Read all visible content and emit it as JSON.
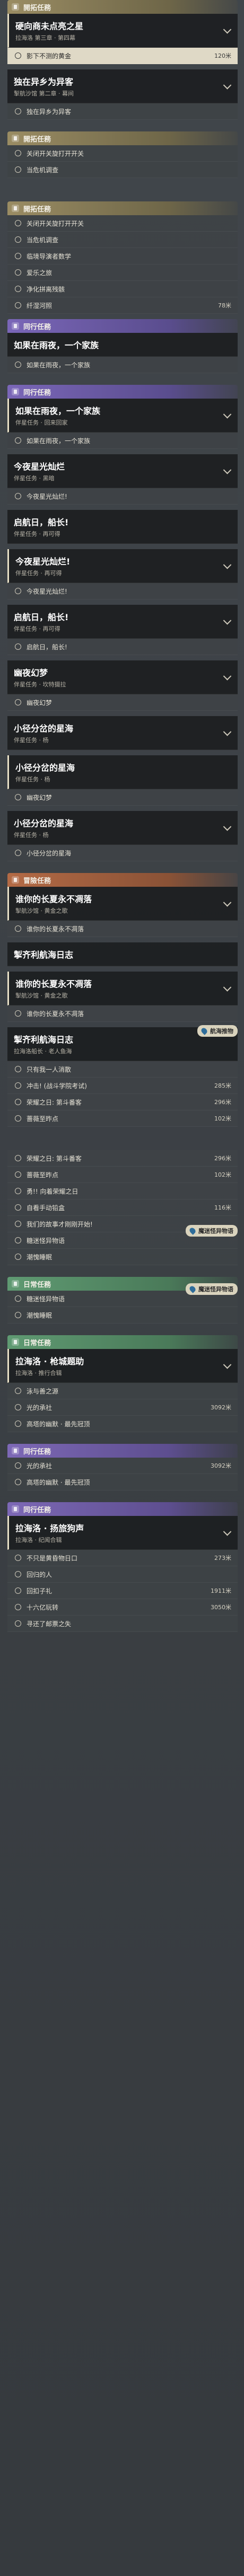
{
  "sections": {
    "trail": "開拓任務",
    "companion": "同行任務",
    "adventure": "冒險任務",
    "daily": "日常任務",
    "side": "同行任務"
  },
  "q1": {
    "title": "硬向商未点亮之星",
    "sub": "拉海洛 第三章 · 第四幕",
    "objectives": [
      {
        "label": "影下不测的黄金",
        "dist": "120米",
        "highlight": true
      }
    ]
  },
  "q2": {
    "title": "独在异乡为异客",
    "sub": "掣航沙馆 第二章 · 幕间",
    "objectives": [
      {
        "label": "独在异乡为异客",
        "dist": ""
      }
    ]
  },
  "q3": {
    "objectives": [
      {
        "label": "关闭开关旋打开开关",
        "dist": ""
      },
      {
        "label": "当危机调查",
        "dist": ""
      }
    ]
  },
  "q4": {
    "objectives": [
      {
        "label": "关闭开关旋打开开关",
        "dist": ""
      },
      {
        "label": "当危机调查",
        "dist": ""
      },
      {
        "label": "临境导演者数学",
        "dist": ""
      },
      {
        "label": "爱乐之旅",
        "dist": ""
      },
      {
        "label": "净化拼离残骸",
        "dist": ""
      },
      {
        "label": "纤湿河照",
        "dist": "78米"
      }
    ]
  },
  "q5": {
    "title": "如果在雨夜，一个家族",
    "sub": "伴星任务 · 回来回家",
    "objectives": [
      {
        "label": "如果在雨夜，一个家族",
        "dist": ""
      }
    ]
  },
  "q6": {
    "title": "今夜星光灿烂",
    "sub": "伴星任务 · 黑暗",
    "objectives": [
      {
        "label": "今夜星光灿烂!",
        "dist": ""
      }
    ]
  },
  "q7": {
    "title": "启航日，船长!",
    "sub": "伴星任务 · 再可得",
    "objectives": []
  },
  "q8": {
    "title": "今夜星光灿烂!",
    "sub": "伴星任务 · 再可得",
    "objectives": [
      {
        "label": "今夜星光灿烂!",
        "dist": ""
      }
    ]
  },
  "q9": {
    "title": "启航日，船长!",
    "sub": "伴星任务 · 再可得",
    "objectives": [
      {
        "label": "启航日，船长!",
        "dist": ""
      }
    ]
  },
  "q10": {
    "title": "幽夜幻梦",
    "sub": "伴星任务 · 坎特摄拉",
    "objectives": [
      {
        "label": "幽夜幻梦",
        "dist": ""
      }
    ]
  },
  "q11": {
    "title": "小径分岔的星海",
    "sub": "伴星任务 · 杨",
    "objectives": [
      {
        "label": "幽夜幻梦",
        "dist": ""
      }
    ]
  },
  "q12": {
    "title": "小径分岔的星海",
    "sub": "伴星任务 · 杨",
    "objectives": [
      {
        "label": "小径分岔的星海",
        "dist": ""
      }
    ]
  },
  "q13": {
    "title": "谁你的长夏永不凋落",
    "sub": "掣航沙馆 · 黄金之歌",
    "objectives": [
      {
        "label": "谁你的长夏永不凋落",
        "dist": ""
      }
    ]
  },
  "q14": {
    "title": "掣齐利航海日志",
    "sub": "",
    "objectives": []
  },
  "q15": {
    "title": "谁你的长夏永不凋落",
    "sub": "掣航沙馆 · 黄金之歌",
    "objectives": [
      {
        "label": "谁你的长夏永不凋落",
        "dist": ""
      }
    ]
  },
  "q16": {
    "title": "掣齐利航海日志",
    "sub": "拉海洛船长 · 老人鱼海",
    "tag": "航海推物",
    "objectives": [
      {
        "label": "只有我一人消散",
        "dist": ""
      },
      {
        "label": "冲击! (战斗学院考试)",
        "dist": "285米"
      },
      {
        "label": "荣耀之日: 第斗番客",
        "dist": "296米"
      },
      {
        "label": "蔷薇至昨点",
        "dist": "102米"
      }
    ]
  },
  "q17": {
    "objectives": [
      {
        "label": "荣耀之日: 第斗番客",
        "dist": "296米"
      },
      {
        "label": "蔷薇至昨点",
        "dist": "102米"
      },
      {
        "label": "勇!!  向着荣耀之日",
        "dist": ""
      },
      {
        "label": "自看手动铅盒",
        "dist": "116米"
      },
      {
        "label": "我们的故事才刚刚开始!",
        "dist": ""
      },
      {
        "label": "糖迷怪异物语",
        "dist": ""
      },
      {
        "label": "潮愧睡眠",
        "dist": ""
      }
    ],
    "tag": "魔迷怪异物语"
  },
  "q18": {
    "tag": "魔迷怪异物语",
    "objectives": [
      {
        "label": "糖迷怪异物语",
        "dist": ""
      },
      {
        "label": "潮愧睡眠",
        "dist": ""
      }
    ]
  },
  "q19": {
    "title": "拉海洛 · 枪城题助",
    "sub": "拉海洛 · 推行合辑",
    "objectives": [
      {
        "label": "泳与善之源",
        "dist": ""
      },
      {
        "label": "光的承社",
        "dist": "3092米"
      },
      {
        "label": "高塔的幽默 · 最先冠顶",
        "dist": ""
      }
    ]
  },
  "q20": {
    "objectives": [
      {
        "label": "光的承社",
        "dist": "3092米"
      },
      {
        "label": "高塔的幽默 · 最先冠顶",
        "dist": ""
      }
    ]
  },
  "q21": {
    "title": "拉海洛 · 扬旅狗声",
    "sub": "拉海洛 · 纪闻合辑",
    "objectives": [
      {
        "label": "不只是黄昏物日口",
        "dist": "273米"
      },
      {
        "label": "回归的人",
        "dist": ""
      },
      {
        "label": "回扣子礼",
        "dist": "1911米"
      },
      {
        "label": "十六亿玩转",
        "dist": "3050米"
      },
      {
        "label": "寻还了邮票之失",
        "dist": ""
      }
    ]
  }
}
